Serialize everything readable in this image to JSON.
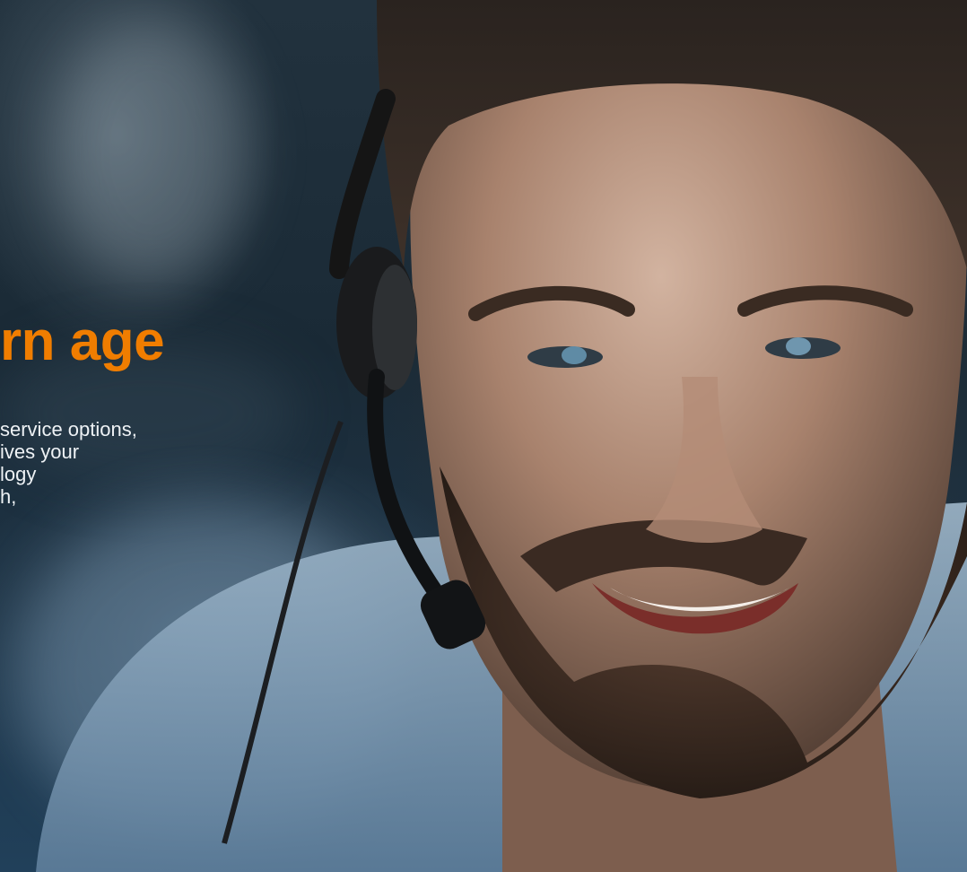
{
  "hero": {
    "headline": "rn age",
    "body_lines": [
      "service options,",
      "ives your",
      "logy",
      "h,"
    ],
    "accent_color": "#f07d00",
    "text_color": "#eef2f5",
    "image_subject": "smiling man wearing call-center headset"
  }
}
